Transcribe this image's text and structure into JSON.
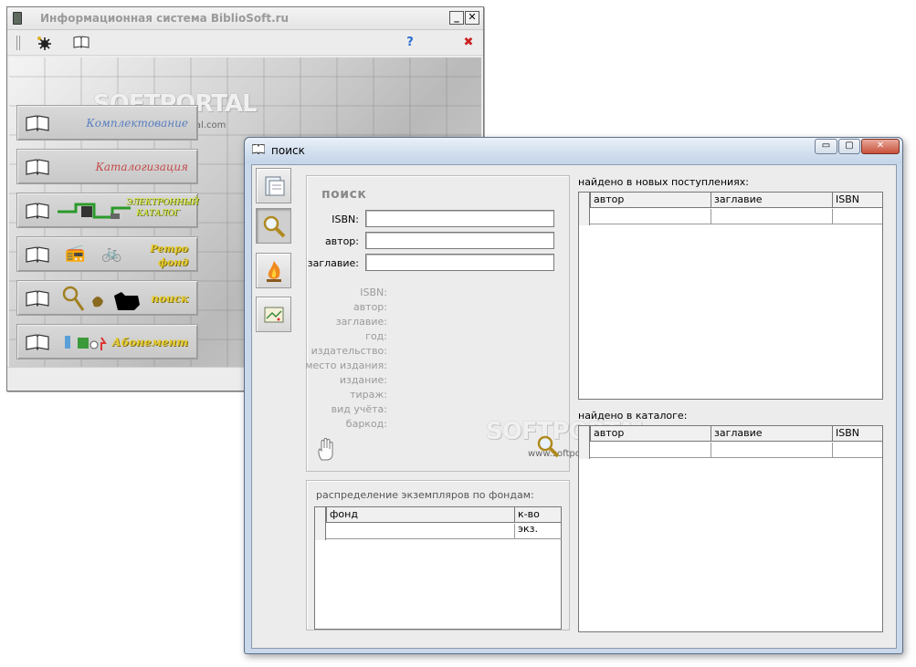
{
  "back_window": {
    "title": "Информационная система BiblioSoft.ru",
    "minimize_glyph": "_",
    "close_glyph": "✕",
    "toolbar": {
      "settings_icon": "gear-icon",
      "book_icon": "book-icon",
      "help_glyph": "?",
      "exit_glyph": "✖"
    },
    "menu": [
      {
        "label": "Комплектование",
        "style": "blue"
      },
      {
        "label": "Каталогизация",
        "style": "red"
      },
      {
        "label": "ЭЛЕКТРОННЫЙ КАТАЛОГ",
        "style": "catalog"
      },
      {
        "label": "Ретро фонд",
        "style": "yellow"
      },
      {
        "label": "поиск",
        "style": "yellow"
      },
      {
        "label": "Абонемент",
        "style": "yellow"
      }
    ],
    "watermark": "SOFTPORTAL",
    "watermark_url": "www.softportal.com"
  },
  "front_window": {
    "title": "поиск",
    "caption_buttons": {
      "minimize": "▭",
      "maximize": "▢",
      "close": "✕"
    },
    "side_tools": [
      "document-icon",
      "magnifier-icon",
      "fire-icon",
      "envelope-icon"
    ],
    "search_panel": {
      "heading": "поиск",
      "fields": [
        {
          "label": "ISBN:",
          "value": ""
        },
        {
          "label": "автор:",
          "value": ""
        },
        {
          "label": "заглавие:",
          "value": ""
        }
      ],
      "info_labels": [
        "ISBN:",
        "автор:",
        "заглавие:",
        "год:",
        "издательство:",
        "место издания:",
        "издание:",
        "тираж:",
        "вид учёта:",
        "баркод:"
      ],
      "watermark": "SOFTPORTAL",
      "watermark_url": "www.softportal.com"
    },
    "distribution": {
      "title": "распределение экземпляров по фондам:",
      "columns": [
        "фонд",
        "к-во экз."
      ]
    },
    "new_arrivals": {
      "title": "найдено в новых поступлениях:",
      "columns": [
        "автор",
        "заглавие",
        "ISBN"
      ]
    },
    "catalog": {
      "title": "найдено в каталоге:",
      "columns": [
        "автор",
        "заглавие",
        "ISBN"
      ]
    }
  }
}
